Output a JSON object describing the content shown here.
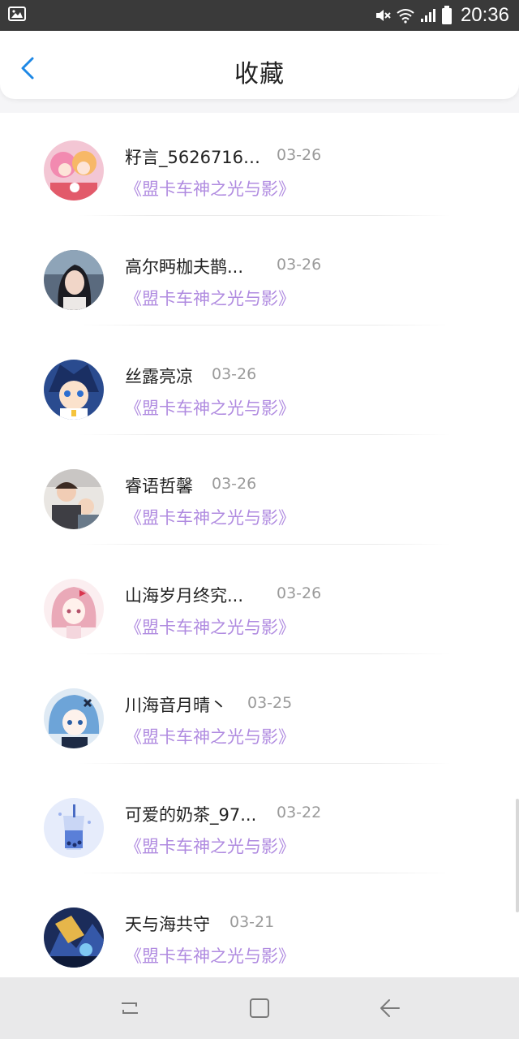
{
  "status_bar": {
    "time": "20:36",
    "icons": [
      "image-icon",
      "mute-icon",
      "wifi-icon",
      "signal-icon",
      "battery-icon"
    ]
  },
  "header": {
    "title": "收藏",
    "back_icon": "chevron-left-icon"
  },
  "colors": {
    "accent": "#1e88e5",
    "title_purple": "#b08be0",
    "date_gray": "#9a9a9a"
  },
  "favorites": [
    {
      "name": "籽言_56267166...",
      "date": "03-26",
      "title": "《盟卡车神之光与影》"
    },
    {
      "name": "高尔眄枷夫鹊...",
      "date": "03-26",
      "title": "《盟卡车神之光与影》"
    },
    {
      "name": "丝露亮凉",
      "date": "03-26",
      "title": "《盟卡车神之光与影》"
    },
    {
      "name": "睿语哲馨",
      "date": "03-26",
      "title": "《盟卡车神之光与影》"
    },
    {
      "name": "山海岁月终究...",
      "date": "03-26",
      "title": "《盟卡车神之光与影》"
    },
    {
      "name": "川海音月晴丶",
      "date": "03-25",
      "title": "《盟卡车神之光与影》"
    },
    {
      "name": "可爱的奶茶_97...",
      "date": "03-22",
      "title": "《盟卡车神之光与影》"
    },
    {
      "name": "天与海共守",
      "date": "03-21",
      "title": "《盟卡车神之光与影》"
    }
  ],
  "nav_bar": {
    "icons": [
      "recent-apps-icon",
      "home-icon",
      "back-icon"
    ]
  }
}
